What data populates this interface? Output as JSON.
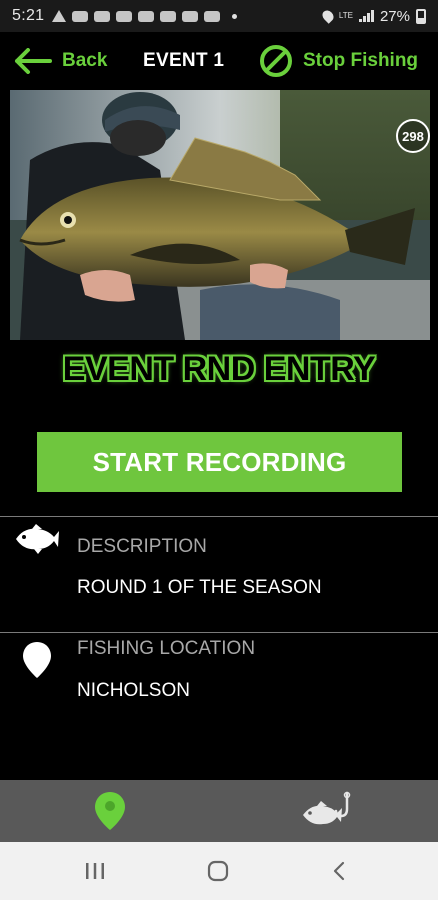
{
  "status_bar": {
    "time": "5:21",
    "network_label": "LTE",
    "battery": "27%"
  },
  "top_bar": {
    "back_label": "Back",
    "title": "EVENT 1",
    "stop_label": "Stop Fishing",
    "accent_color": "#6ad03c"
  },
  "hero": {
    "photo_count": "298",
    "icon": "fish-photo"
  },
  "event": {
    "headline": "EVENT RND ENTRY",
    "start_button_label": "START RECORDING",
    "button_color": "#6fc63e"
  },
  "details": {
    "description": {
      "icon": "fish-icon",
      "label": "DESCRIPTION",
      "value": "ROUND 1 OF THE SEASON"
    },
    "location": {
      "icon": "map-pin-icon",
      "label": "FISHING LOCATION",
      "value": "NICHOLSON"
    }
  },
  "bottom_nav": {
    "items": [
      {
        "icon": "map-pin-icon",
        "active": true,
        "color": "#6ad03c"
      },
      {
        "icon": "fish-hook-icon",
        "active": false,
        "color": "#e8e8e8"
      }
    ]
  },
  "system_nav": {
    "items": [
      "recent-apps-icon",
      "home-icon",
      "back-icon"
    ]
  }
}
